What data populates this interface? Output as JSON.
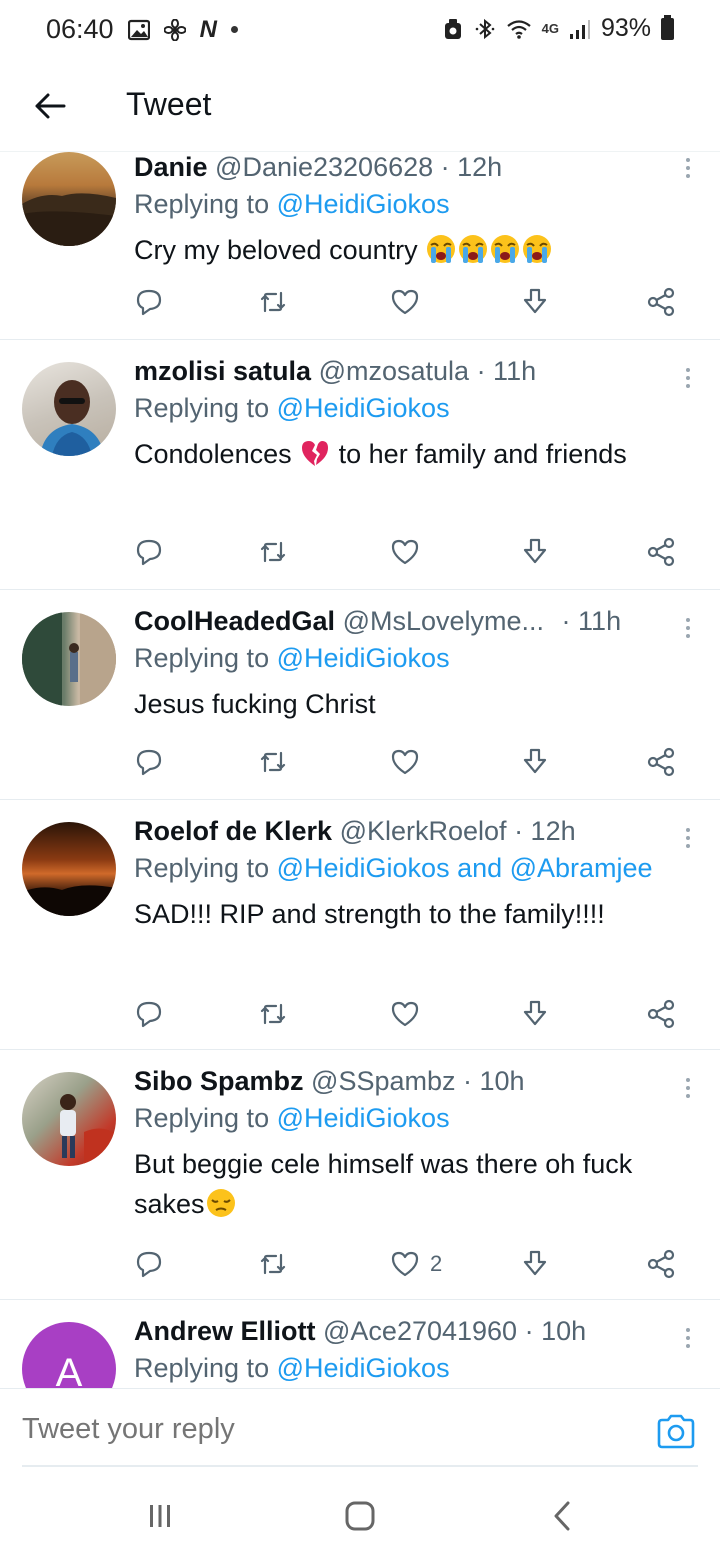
{
  "status_bar": {
    "time": "06:40",
    "notif_icons": [
      "image-icon",
      "fan-icon",
      "n-icon"
    ],
    "n_label": "N",
    "right_icons": [
      "recycle-icon",
      "bluetooth-icon",
      "wifi-icon",
      "4g-icon",
      "signal-icon"
    ],
    "network": "4G",
    "battery": "93%"
  },
  "header": {
    "title": "Tweet"
  },
  "tweets": [
    {
      "name": "Danie",
      "handle": "@Danie23206628",
      "time": "· 12h",
      "reply_prefix": "Replying to ",
      "reply_to": "@HeidiGiokos",
      "text": "Cry my beloved country",
      "emoji": [
        "crying-face",
        "crying-face",
        "crying-face",
        "crying-face"
      ],
      "likes": ""
    },
    {
      "name": "mzolisi satula",
      "handle": "@mzosatula",
      "time": "· 11h",
      "reply_prefix": "Replying to ",
      "reply_to": "@HeidiGiokos",
      "text_before": "Condolences",
      "text_after": " to her family and friends",
      "emoji": [
        "broken-heart"
      ],
      "likes": ""
    },
    {
      "name": "CoolHeadedGal",
      "handle": "@MsLovelyme...",
      "time": "· 11h",
      "reply_prefix": "Replying to ",
      "reply_to": "@HeidiGiokos",
      "text": "Jesus fucking Christ",
      "likes": ""
    },
    {
      "name": "Roelof de Klerk",
      "handle": "@KlerkRoelof",
      "time": "· 12h",
      "reply_prefix": "Replying to ",
      "reply_to": "@HeidiGiokos and @Abramjee",
      "text": "SAD!!! RIP and strength to the family!!!!",
      "likes": ""
    },
    {
      "name": "Sibo Spambz",
      "handle": "@SSpambz",
      "time": "· 10h",
      "reply_prefix": "Replying to ",
      "reply_to": "@HeidiGiokos",
      "text": "But beggie cele himself was there oh fuck sakes",
      "emoji": [
        "pensive-face"
      ],
      "likes": "2"
    },
    {
      "name": "Andrew Elliott",
      "handle": "@Ace27041960",
      "time": "· 10h",
      "reply_prefix": "Replying to ",
      "reply_to": "@HeidiGiokos",
      "avatar_letter": "A",
      "likes": ""
    }
  ],
  "reply_bar": {
    "placeholder": "Tweet your reply"
  },
  "colors": {
    "accent": "#1d9bf0",
    "text_primary": "#0f1419",
    "text_secondary": "#536471",
    "avatar_purple": "#a83fc4"
  },
  "nav_bar": {
    "icons": [
      "recents-icon",
      "home-icon",
      "back-icon"
    ]
  }
}
